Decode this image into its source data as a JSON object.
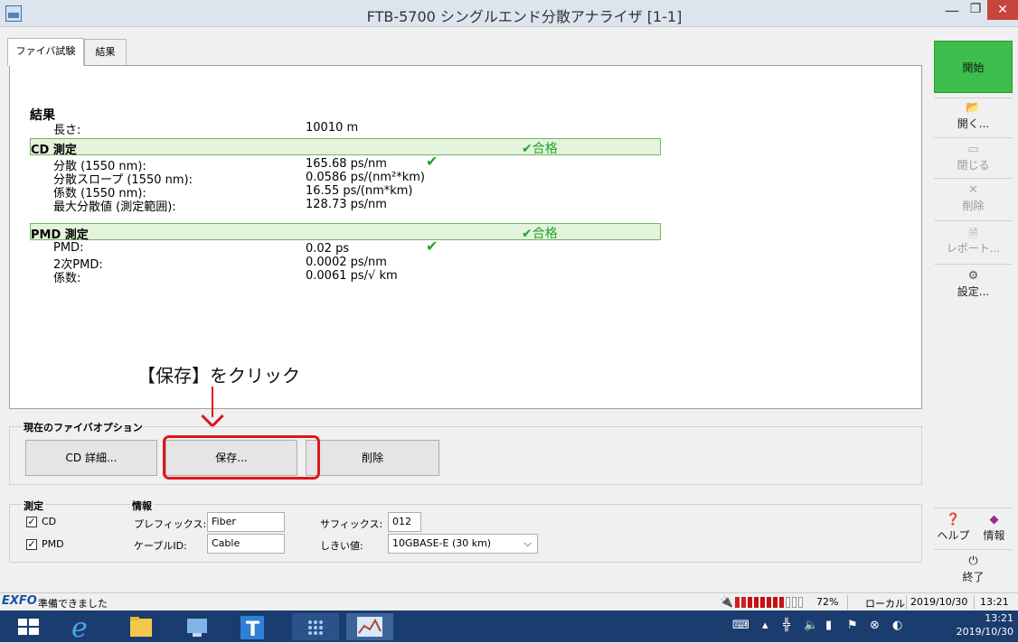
{
  "window": {
    "title": "FTB-5700 シングルエンド分散アナライザ [1-1]",
    "min_glyph": "—",
    "max_glyph": "❐",
    "close_glyph": "✕"
  },
  "tabs": [
    {
      "label": "ファイバ試験"
    },
    {
      "label": "結果"
    }
  ],
  "results": {
    "heading": "結果",
    "length_label": "長さ:",
    "length_value": "10010 m",
    "cd": {
      "title": "CD 測定",
      "status": "合格",
      "rows": [
        {
          "label": "分散 (1550 nm):",
          "value": "165.68 ps/nm",
          "check": true
        },
        {
          "label": "分散スロープ (1550 nm):",
          "value": "0.0586 ps/(nm²*km)"
        },
        {
          "label": "係数 (1550 nm):",
          "value": "16.55 ps/(nm*km)"
        },
        {
          "label": "最大分散値 (測定範囲):",
          "value": "128.73 ps/nm"
        }
      ]
    },
    "pmd": {
      "title": "PMD 測定",
      "status": "合格",
      "rows": [
        {
          "label": "PMD:",
          "value": "0.02 ps",
          "check": true
        },
        {
          "label": "2次PMD:",
          "value": "0.0002 ps/nm"
        },
        {
          "label": "係数:",
          "value": "0.0061 ps/√ km"
        }
      ]
    }
  },
  "annotation": "【保存】をクリック",
  "fiber_options": {
    "title": "現在のファイバオプション",
    "cd_detail_label": "CD 詳細...",
    "save_label": "保存...",
    "delete_label": "削除"
  },
  "measurement": {
    "title": "測定",
    "cd_label": "CD",
    "pmd_label": "PMD"
  },
  "info": {
    "title": "情報",
    "prefix_label": "プレフィックス:",
    "prefix_value": "Fiber",
    "suffix_label": "サフィックス:",
    "suffix_value": "012",
    "cable_label": "ケーブルID:",
    "cable_value": "Cable",
    "threshold_label": "しきい値:",
    "threshold_value": "10GBASE-E (30 km)"
  },
  "sidebar": {
    "start_label": "開始",
    "open_label": "開く...",
    "close_label": "閉じる",
    "delete_label": "削除",
    "report_label": "レポート...",
    "settings_label": "設定...",
    "help_label": "ヘルプ",
    "info_label": "情報",
    "exit_label": "終了"
  },
  "statusbar": {
    "brand": "EXFO",
    "status": "準備できました",
    "battery": "72%",
    "battery_level": 0.72,
    "mode": "ローカル",
    "date": "2019/10/30",
    "time": "13:21"
  },
  "taskbar": {
    "clock_time": "13:21",
    "clock_date": "2019/10/30"
  },
  "colors": {
    "accent_start": "#3dbd4b",
    "pass_green": "#21a32c",
    "highlight_red": "#e0161d",
    "taskbar": "#1b3c6e"
  }
}
